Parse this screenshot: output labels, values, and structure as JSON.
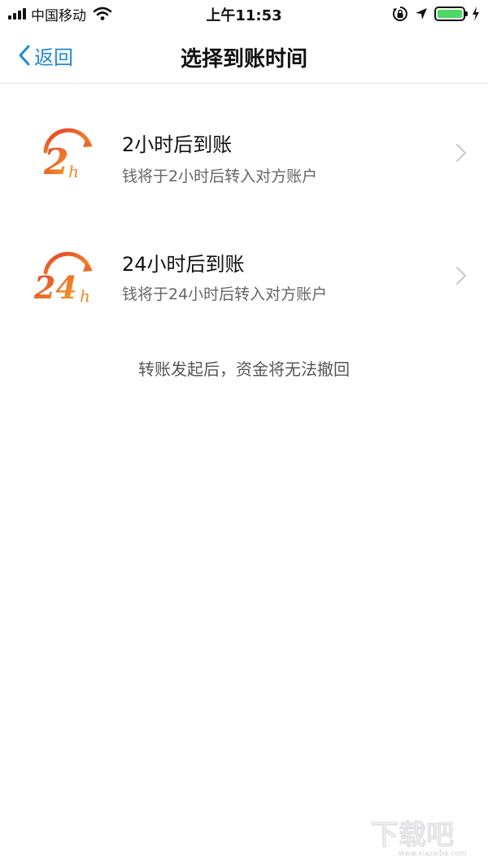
{
  "status_bar": {
    "carrier": "中国移动",
    "time": "上午11:53",
    "battery_color": "#4cd964"
  },
  "nav": {
    "back_label": "返回",
    "title": "选择到账时间",
    "accent_color": "#1f8ad6"
  },
  "options": [
    {
      "icon_number": "2",
      "icon_unit": "h",
      "title": "2小时后到账",
      "subtitle": "钱将于2小时后转入对方账户"
    },
    {
      "icon_number": "24",
      "icon_unit": "h",
      "title": "24小时后到账",
      "subtitle": "钱将于24小时后转入对方账户"
    }
  ],
  "notice": "转账发起后，资金将无法撤回",
  "icons": {
    "signal": "signal-icon",
    "wifi": "wifi-icon",
    "orientation_lock": "orientation-lock-icon",
    "location": "location-arrow-icon",
    "battery": "battery-icon",
    "charging": "charging-bolt-icon",
    "back": "chevron-left-icon",
    "disclosure": "chevron-right-icon"
  },
  "watermark": {
    "text": "下载吧",
    "url_text": "www.xiazaiba.com"
  }
}
